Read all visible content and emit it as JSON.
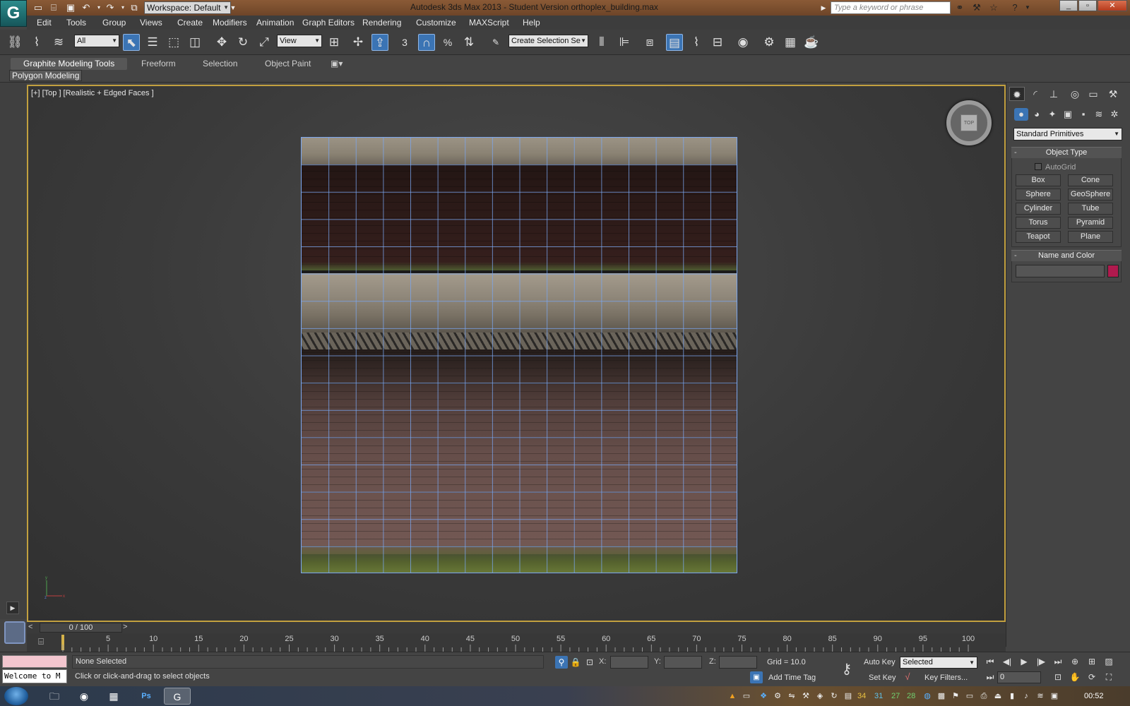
{
  "titlebar": {
    "title": "Autodesk 3ds Max  2013  - Student Version   orthoplex_building.max",
    "workspace": "Workspace: Default",
    "search_placeholder": "Type a keyword or phrase"
  },
  "menu": [
    "Edit",
    "Tools",
    "Group",
    "Views",
    "Create",
    "Modifiers",
    "Animation",
    "Graph Editors",
    "Rendering",
    "Customize",
    "MAXScript",
    "Help"
  ],
  "toolbar": {
    "filter_value": "All",
    "reference_coord": "View",
    "snap_3d": "3",
    "angle_snap_label": "%",
    "named_selection_placeholder": "Create Selection Se"
  },
  "ribbon": {
    "tabs": [
      "Graphite Modeling Tools",
      "Freeform",
      "Selection",
      "Object Paint"
    ],
    "panel_label": "Polygon Modeling"
  },
  "viewport": {
    "label": "[+] [Top ] [Realistic + Edged Faces ]",
    "viewcube_face": "TOP",
    "grid_divisions": 16
  },
  "command_panel": {
    "category_dropdown": "Standard Primitives",
    "object_type_title": "Object Type",
    "autogrid_label": "AutoGrid",
    "primitives": [
      "Box",
      "Cone",
      "Sphere",
      "GeoSphere",
      "Cylinder",
      "Tube",
      "Torus",
      "Pyramid",
      "Teapot",
      "Plane"
    ],
    "name_color_title": "Name and Color",
    "object_color": "#b01a4e"
  },
  "timeline": {
    "frame_display": "0 / 100",
    "prev_symbol": "<",
    "next_symbol": ">",
    "tick_labels": [
      "5",
      "10",
      "15",
      "20",
      "25",
      "30",
      "35",
      "40",
      "45",
      "50",
      "55",
      "60",
      "65",
      "70",
      "75",
      "80",
      "85",
      "90",
      "95",
      "100"
    ]
  },
  "status": {
    "maxscript_listener": "Welcome to M",
    "selection": "None Selected",
    "prompt": "Click or click-and-drag to select objects",
    "x_label": "X:",
    "y_label": "Y:",
    "z_label": "Z:",
    "grid": "Grid = 10.0",
    "add_time_tag": "Add Time Tag",
    "auto_key": "Auto Key",
    "set_key": "Set Key",
    "key_mode": "Selected",
    "key_filters": "Key Filters...",
    "current_frame": "0"
  },
  "taskbar": {
    "tray_numbers": [
      "34",
      "31",
      "27",
      "28"
    ],
    "clock": "00:52"
  },
  "colors": {
    "viewport_border": "#c2a03f",
    "active_blue": "#3b74b4",
    "wireframe": "#7aa6f0"
  }
}
